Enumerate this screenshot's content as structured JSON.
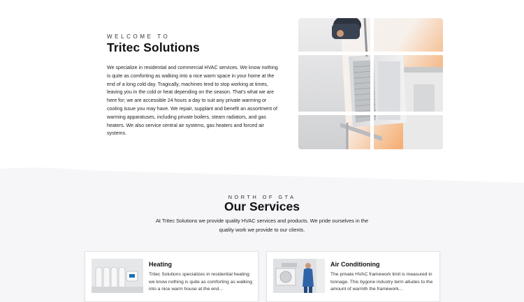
{
  "about": {
    "eyebrow": "WELCOME TO",
    "title": "Tritec Solutions",
    "text": "We specialize in residential and commercial HVAC services. We know nothing is quite as comforting as walking into a nice warm space in your home at the end of a long cold day. Tragically, machines tend to stop working at times, leaving you in the cold or heat depending on the season. That's what we are here for; we are accessible 24 hours a day to suit any private warming or cooling issue you may have. We repair, supplant and benefit an assortment of warming apparatuses, including private boilers, steam radiators, and gas heaters. We also service central air systems, gas heaters and forced air systems."
  },
  "services": {
    "eyebrow": "NORTH OF GTA",
    "title": "Our Services",
    "intro": "At Tritec Solutions we provide quality HVAC services and products. We pride ourselves in the quality work we provide to our clients.",
    "cards": [
      {
        "title": "Heating",
        "text": "Tritec Solutions specializes in residential heating; we know nothing is quite as comforting as walking into a nice warm house at the end...",
        "icon": "radiator-thermostat-image"
      },
      {
        "title": "Air Conditioning",
        "text": "The private HVAC framework limit is measured in tonnage. This bygone industry term alludes to the amount of warmth the framework...",
        "icon": "technician-ac-unit-image"
      }
    ]
  },
  "colors": {
    "services_bg": "#f6f6f8",
    "accent_orange": "#f39a52"
  }
}
